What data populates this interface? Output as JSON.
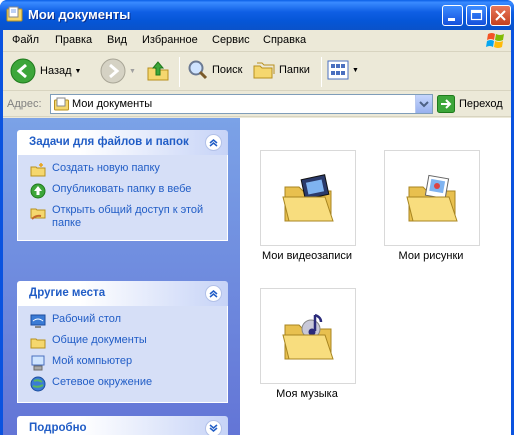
{
  "window": {
    "title": "Мои документы"
  },
  "menu": [
    "Файл",
    "Правка",
    "Вид",
    "Избранное",
    "Сервис",
    "Справка"
  ],
  "toolbar": {
    "back": "Назад",
    "search": "Поиск",
    "folders": "Папки"
  },
  "address": {
    "label": "Адрес:",
    "value": "Мои документы",
    "go": "Переход"
  },
  "tasks_panel": {
    "title": "Задачи для файлов и папок",
    "items": [
      "Создать новую папку",
      "Опубликовать папку в вебе",
      "Открыть общий доступ к этой папке"
    ]
  },
  "places_panel": {
    "title": "Другие места",
    "items": [
      "Рабочий стол",
      "Общие документы",
      "Мой компьютер",
      "Сетевое окружение"
    ]
  },
  "details_panel": {
    "title": "Подробно"
  },
  "folders": [
    "Мои видеозаписи",
    "Мои рисунки",
    "Моя музыка"
  ],
  "colors": {
    "title_bar": "#0A53E0",
    "task_link": "#215DC6",
    "pane_top": "#7BA2E7",
    "pane_bottom": "#6375D6"
  }
}
